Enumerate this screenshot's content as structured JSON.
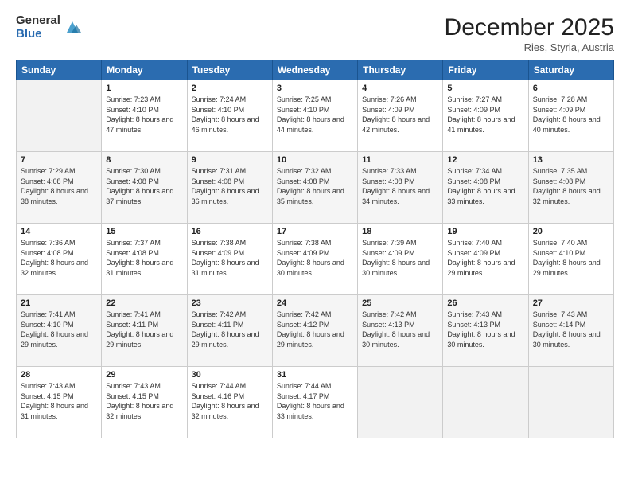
{
  "logo": {
    "general": "General",
    "blue": "Blue"
  },
  "header": {
    "month": "December 2025",
    "location": "Ries, Styria, Austria"
  },
  "weekdays": [
    "Sunday",
    "Monday",
    "Tuesday",
    "Wednesday",
    "Thursday",
    "Friday",
    "Saturday"
  ],
  "weeks": [
    [
      {
        "day": "",
        "sunrise": "",
        "sunset": "",
        "daylight": ""
      },
      {
        "day": "1",
        "sunrise": "Sunrise: 7:23 AM",
        "sunset": "Sunset: 4:10 PM",
        "daylight": "Daylight: 8 hours and 47 minutes."
      },
      {
        "day": "2",
        "sunrise": "Sunrise: 7:24 AM",
        "sunset": "Sunset: 4:10 PM",
        "daylight": "Daylight: 8 hours and 46 minutes."
      },
      {
        "day": "3",
        "sunrise": "Sunrise: 7:25 AM",
        "sunset": "Sunset: 4:10 PM",
        "daylight": "Daylight: 8 hours and 44 minutes."
      },
      {
        "day": "4",
        "sunrise": "Sunrise: 7:26 AM",
        "sunset": "Sunset: 4:09 PM",
        "daylight": "Daylight: 8 hours and 42 minutes."
      },
      {
        "day": "5",
        "sunrise": "Sunrise: 7:27 AM",
        "sunset": "Sunset: 4:09 PM",
        "daylight": "Daylight: 8 hours and 41 minutes."
      },
      {
        "day": "6",
        "sunrise": "Sunrise: 7:28 AM",
        "sunset": "Sunset: 4:09 PM",
        "daylight": "Daylight: 8 hours and 40 minutes."
      }
    ],
    [
      {
        "day": "7",
        "sunrise": "Sunrise: 7:29 AM",
        "sunset": "Sunset: 4:08 PM",
        "daylight": "Daylight: 8 hours and 38 minutes."
      },
      {
        "day": "8",
        "sunrise": "Sunrise: 7:30 AM",
        "sunset": "Sunset: 4:08 PM",
        "daylight": "Daylight: 8 hours and 37 minutes."
      },
      {
        "day": "9",
        "sunrise": "Sunrise: 7:31 AM",
        "sunset": "Sunset: 4:08 PM",
        "daylight": "Daylight: 8 hours and 36 minutes."
      },
      {
        "day": "10",
        "sunrise": "Sunrise: 7:32 AM",
        "sunset": "Sunset: 4:08 PM",
        "daylight": "Daylight: 8 hours and 35 minutes."
      },
      {
        "day": "11",
        "sunrise": "Sunrise: 7:33 AM",
        "sunset": "Sunset: 4:08 PM",
        "daylight": "Daylight: 8 hours and 34 minutes."
      },
      {
        "day": "12",
        "sunrise": "Sunrise: 7:34 AM",
        "sunset": "Sunset: 4:08 PM",
        "daylight": "Daylight: 8 hours and 33 minutes."
      },
      {
        "day": "13",
        "sunrise": "Sunrise: 7:35 AM",
        "sunset": "Sunset: 4:08 PM",
        "daylight": "Daylight: 8 hours and 32 minutes."
      }
    ],
    [
      {
        "day": "14",
        "sunrise": "Sunrise: 7:36 AM",
        "sunset": "Sunset: 4:08 PM",
        "daylight": "Daylight: 8 hours and 32 minutes."
      },
      {
        "day": "15",
        "sunrise": "Sunrise: 7:37 AM",
        "sunset": "Sunset: 4:08 PM",
        "daylight": "Daylight: 8 hours and 31 minutes."
      },
      {
        "day": "16",
        "sunrise": "Sunrise: 7:38 AM",
        "sunset": "Sunset: 4:09 PM",
        "daylight": "Daylight: 8 hours and 31 minutes."
      },
      {
        "day": "17",
        "sunrise": "Sunrise: 7:38 AM",
        "sunset": "Sunset: 4:09 PM",
        "daylight": "Daylight: 8 hours and 30 minutes."
      },
      {
        "day": "18",
        "sunrise": "Sunrise: 7:39 AM",
        "sunset": "Sunset: 4:09 PM",
        "daylight": "Daylight: 8 hours and 30 minutes."
      },
      {
        "day": "19",
        "sunrise": "Sunrise: 7:40 AM",
        "sunset": "Sunset: 4:09 PM",
        "daylight": "Daylight: 8 hours and 29 minutes."
      },
      {
        "day": "20",
        "sunrise": "Sunrise: 7:40 AM",
        "sunset": "Sunset: 4:10 PM",
        "daylight": "Daylight: 8 hours and 29 minutes."
      }
    ],
    [
      {
        "day": "21",
        "sunrise": "Sunrise: 7:41 AM",
        "sunset": "Sunset: 4:10 PM",
        "daylight": "Daylight: 8 hours and 29 minutes."
      },
      {
        "day": "22",
        "sunrise": "Sunrise: 7:41 AM",
        "sunset": "Sunset: 4:11 PM",
        "daylight": "Daylight: 8 hours and 29 minutes."
      },
      {
        "day": "23",
        "sunrise": "Sunrise: 7:42 AM",
        "sunset": "Sunset: 4:11 PM",
        "daylight": "Daylight: 8 hours and 29 minutes."
      },
      {
        "day": "24",
        "sunrise": "Sunrise: 7:42 AM",
        "sunset": "Sunset: 4:12 PM",
        "daylight": "Daylight: 8 hours and 29 minutes."
      },
      {
        "day": "25",
        "sunrise": "Sunrise: 7:42 AM",
        "sunset": "Sunset: 4:13 PM",
        "daylight": "Daylight: 8 hours and 30 minutes."
      },
      {
        "day": "26",
        "sunrise": "Sunrise: 7:43 AM",
        "sunset": "Sunset: 4:13 PM",
        "daylight": "Daylight: 8 hours and 30 minutes."
      },
      {
        "day": "27",
        "sunrise": "Sunrise: 7:43 AM",
        "sunset": "Sunset: 4:14 PM",
        "daylight": "Daylight: 8 hours and 30 minutes."
      }
    ],
    [
      {
        "day": "28",
        "sunrise": "Sunrise: 7:43 AM",
        "sunset": "Sunset: 4:15 PM",
        "daylight": "Daylight: 8 hours and 31 minutes."
      },
      {
        "day": "29",
        "sunrise": "Sunrise: 7:43 AM",
        "sunset": "Sunset: 4:15 PM",
        "daylight": "Daylight: 8 hours and 32 minutes."
      },
      {
        "day": "30",
        "sunrise": "Sunrise: 7:44 AM",
        "sunset": "Sunset: 4:16 PM",
        "daylight": "Daylight: 8 hours and 32 minutes."
      },
      {
        "day": "31",
        "sunrise": "Sunrise: 7:44 AM",
        "sunset": "Sunset: 4:17 PM",
        "daylight": "Daylight: 8 hours and 33 minutes."
      },
      {
        "day": "",
        "sunrise": "",
        "sunset": "",
        "daylight": ""
      },
      {
        "day": "",
        "sunrise": "",
        "sunset": "",
        "daylight": ""
      },
      {
        "day": "",
        "sunrise": "",
        "sunset": "",
        "daylight": ""
      }
    ]
  ]
}
